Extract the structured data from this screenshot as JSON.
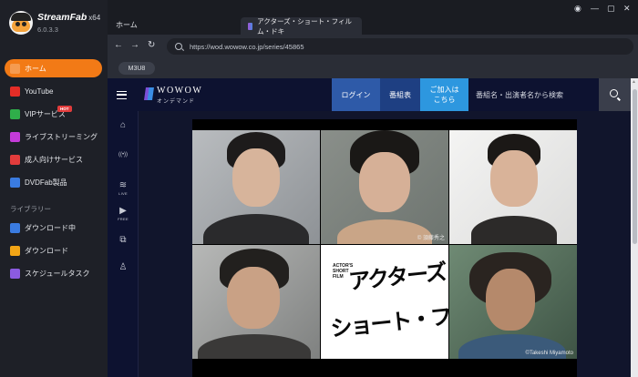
{
  "app": {
    "name": "StreamFab",
    "arch": "x64",
    "version": "6.0.3.3"
  },
  "sidebar": {
    "items": [
      {
        "label": "ホーム",
        "icon": "home-icon",
        "color": "#f27a16",
        "active": true
      },
      {
        "label": "YouTube",
        "icon": "youtube-icon",
        "color": "#e52d27"
      },
      {
        "label": "VIPサービス",
        "icon": "vip-key-icon",
        "color": "#2fae4a",
        "badge": "HOT"
      },
      {
        "label": "ライブストリーミング",
        "icon": "live-stream-icon",
        "color": "#c43bd8"
      },
      {
        "label": "成人向けサービス",
        "icon": "adult-service-icon",
        "color": "#e23c3c"
      },
      {
        "label": "DVDFab製品",
        "icon": "dvdfab-icon",
        "color": "#3a7be0"
      }
    ],
    "library_title": "ライブラリー",
    "library": [
      {
        "label": "ダウンロード中",
        "icon": "downloading-icon",
        "color": "#3a7be0"
      },
      {
        "label": "ダウンロード",
        "icon": "downloaded-icon",
        "color": "#f2a516"
      },
      {
        "label": "スケジュールタスク",
        "icon": "schedule-task-icon",
        "color": "#8b5be0"
      }
    ]
  },
  "tabs": {
    "home": "ホーム",
    "active": "アクターズ・ショート・フィルム・ドキ"
  },
  "window_controls": [
    "◉",
    "—",
    "▢",
    "✕"
  ],
  "address": {
    "back": "←",
    "forward": "→",
    "reload": "↻",
    "url": "https://wod.wowow.co.jp/series/45865"
  },
  "m3u8_label": "M3U8",
  "site": {
    "logo_word": "WOWOW",
    "logo_sub": "オンデマンド",
    "login": "ログイン",
    "guide": "番組表",
    "join_line1": "ご加入は",
    "join_line2": "こちら",
    "search_placeholder": "番組名・出演者名から検索",
    "side_icons": [
      {
        "icon": "home-icon",
        "glyph": "⌂",
        "text": ""
      },
      {
        "icon": "broadcast-icon",
        "glyph": "((•))",
        "text": ""
      },
      {
        "icon": "live-icon",
        "glyph": "≋",
        "text": "LIVE"
      },
      {
        "icon": "free-icon",
        "glyph": "▶",
        "text": "FREE"
      },
      {
        "icon": "library-icon",
        "glyph": "⧉",
        "text": ""
      },
      {
        "icon": "account-icon",
        "glyph": "♙",
        "text": ""
      }
    ]
  },
  "key_visual": {
    "credit_top": "© 須藤秀之",
    "credit_bottom": "©Takeshi Miyamoto",
    "title_small": "ACTOR'S SHORT FILM",
    "title_line1": "アクターズ・",
    "title_line2": "ショート・フィルム"
  }
}
